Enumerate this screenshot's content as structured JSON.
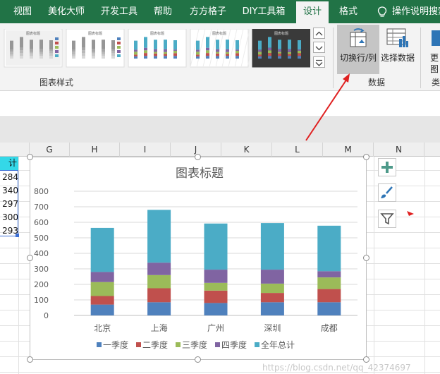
{
  "ribbon_tabs": [
    {
      "label": "视图"
    },
    {
      "label": "美化大师"
    },
    {
      "label": "开发工具"
    },
    {
      "label": "帮助"
    },
    {
      "label": "方方格子"
    },
    {
      "label": "DIY工具箱"
    },
    {
      "label": "设计",
      "active": true
    },
    {
      "label": "格式"
    }
  ],
  "tell_me": "操作说明搜索",
  "ribbon": {
    "chart_styles_label": "图表样式",
    "switch_row_col": "切换行/列",
    "select_data": "选择数据",
    "data_group_label": "数据",
    "cutoff_btn": "更",
    "cutoff_btn2": "图",
    "cutoff_group": "类"
  },
  "thumb_title": "图表标题",
  "columns": [
    "G",
    "H",
    "I",
    "J",
    "K",
    "L",
    "M",
    "N"
  ],
  "cells": {
    "header_fragment": "计",
    "values": [
      "284",
      "340",
      "297",
      "300",
      "293"
    ]
  },
  "chart_data": {
    "type": "bar",
    "stacked": true,
    "title": "图表标题",
    "categories": [
      "北京",
      "上海",
      "广州",
      "深圳",
      "成都"
    ],
    "ylim": [
      0,
      800
    ],
    "yticks": [
      0,
      100,
      200,
      300,
      400,
      500,
      600,
      700,
      800
    ],
    "series": [
      {
        "name": "一季度",
        "color": "#4f81bd",
        "values": [
          70,
          85,
          80,
          85,
          85
        ]
      },
      {
        "name": "二季度",
        "color": "#c0504d",
        "values": [
          55,
          90,
          80,
          60,
          85
        ]
      },
      {
        "name": "三季度",
        "color": "#9bbb59",
        "values": [
          90,
          85,
          50,
          60,
          75
        ]
      },
      {
        "name": "四季度",
        "color": "#8064a2",
        "values": [
          65,
          80,
          85,
          90,
          40
        ]
      },
      {
        "name": "全年总计",
        "color": "#4bacc6",
        "values": [
          284,
          340,
          297,
          300,
          293
        ]
      }
    ],
    "grid": true,
    "legend": "bottom"
  },
  "colors": {
    "ribbon_green": "#217346",
    "annotation_arrow": "#e02020",
    "header_highlight": "#34d8e8"
  },
  "icons": {
    "tell_me": "lightbulb-icon",
    "add_element": "plus-icon",
    "chart_styles": "paintbrush-icon",
    "chart_filter": "funnel-icon"
  },
  "watermark": "https://blog.csdn.net/qq_42374697"
}
